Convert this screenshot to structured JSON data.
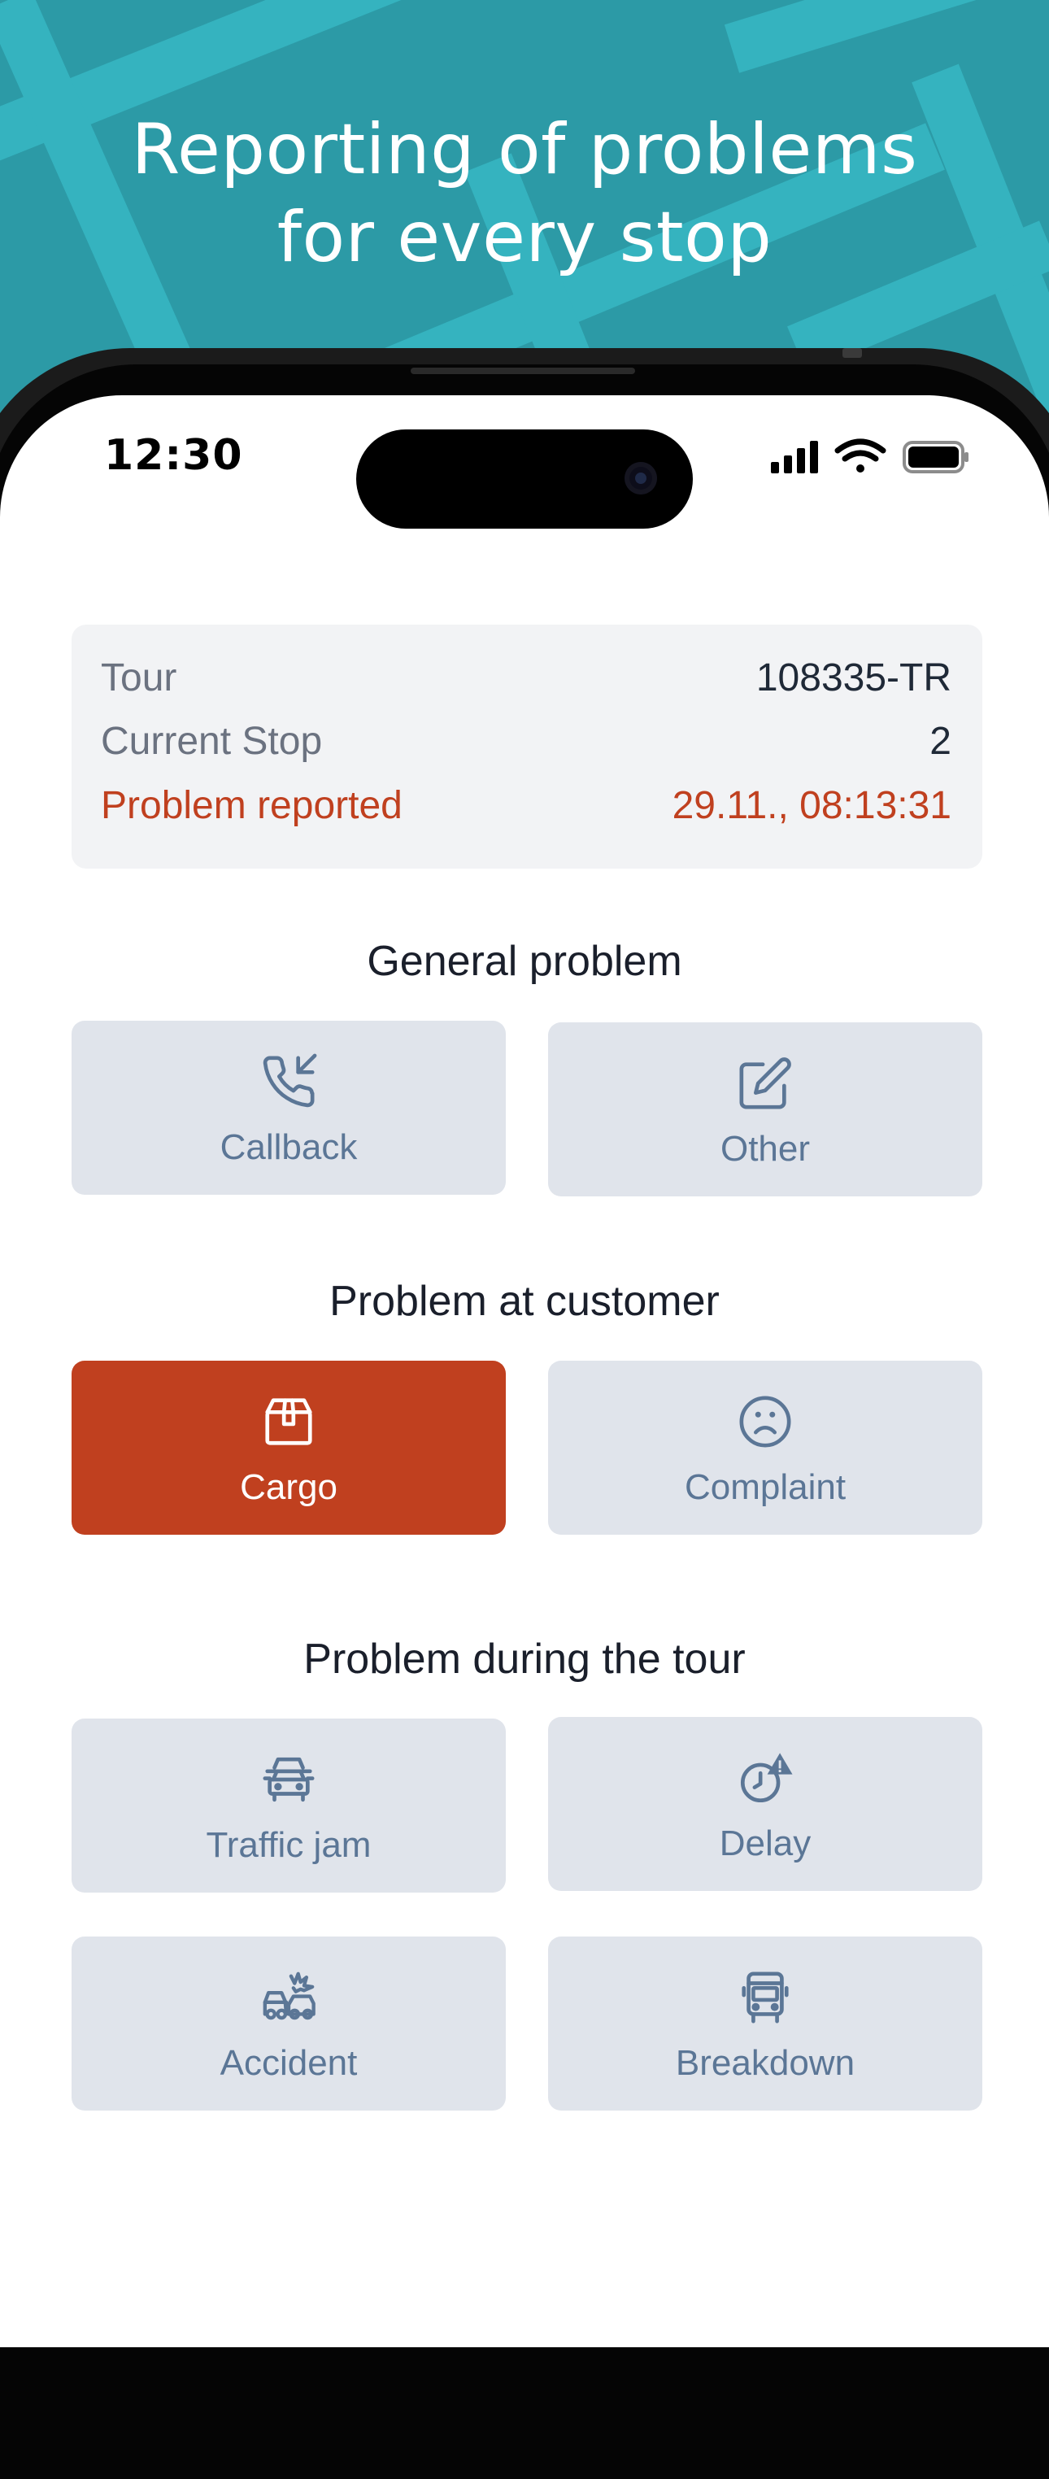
{
  "headline": {
    "line1": "Reporting of problems",
    "line2": "for every stop"
  },
  "colors": {
    "hero_teal": "#2c9aa6",
    "accent_red": "#c0401f",
    "tile_bg": "#e0e4eb",
    "tile_text": "#5b7696"
  },
  "status_bar": {
    "time": "12:30",
    "icons": [
      "cellular-signal-icon",
      "wifi-icon",
      "battery-icon"
    ]
  },
  "info": {
    "tour_label": "Tour",
    "tour_value": "108335-TR",
    "stop_label": "Current Stop",
    "stop_value": "2",
    "problem_label": "Problem reported",
    "problem_value": "29.11., 08:13:31"
  },
  "sections": {
    "general": {
      "title": "General problem",
      "callback": "Callback",
      "other": "Other"
    },
    "customer": {
      "title": "Problem at customer",
      "cargo": "Cargo",
      "complaint": "Complaint",
      "selected": "Cargo"
    },
    "tour": {
      "title": "Problem during the tour",
      "traffic_jam": "Traffic jam",
      "delay": "Delay",
      "accident": "Accident",
      "breakdown": "Breakdown"
    }
  }
}
